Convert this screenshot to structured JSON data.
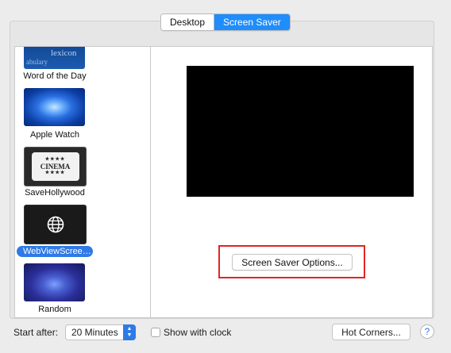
{
  "tabs": {
    "desktop": "Desktop",
    "screen_saver": "Screen Saver",
    "active": "screen_saver"
  },
  "savers": [
    {
      "label": "Word of the Day",
      "thumb_words": [
        "lexicon",
        "abulary"
      ]
    },
    {
      "label": "Apple Watch"
    },
    {
      "label": "SaveHollywood",
      "thumb_text": "CINEMA",
      "stars": "★★★★"
    },
    {
      "label": "WebViewScree…",
      "selected": true
    },
    {
      "label": "Random"
    }
  ],
  "options_button": "Screen Saver Options...",
  "start_after": {
    "label": "Start after:",
    "value": "20 Minutes"
  },
  "show_clock": {
    "label": "Show with clock",
    "checked": false
  },
  "hot_corners": "Hot Corners...",
  "help": "?",
  "colors": {
    "selection": "#2f7ae6",
    "highlight_box": "#e02424",
    "accent_tab": "#1f8dfb"
  }
}
